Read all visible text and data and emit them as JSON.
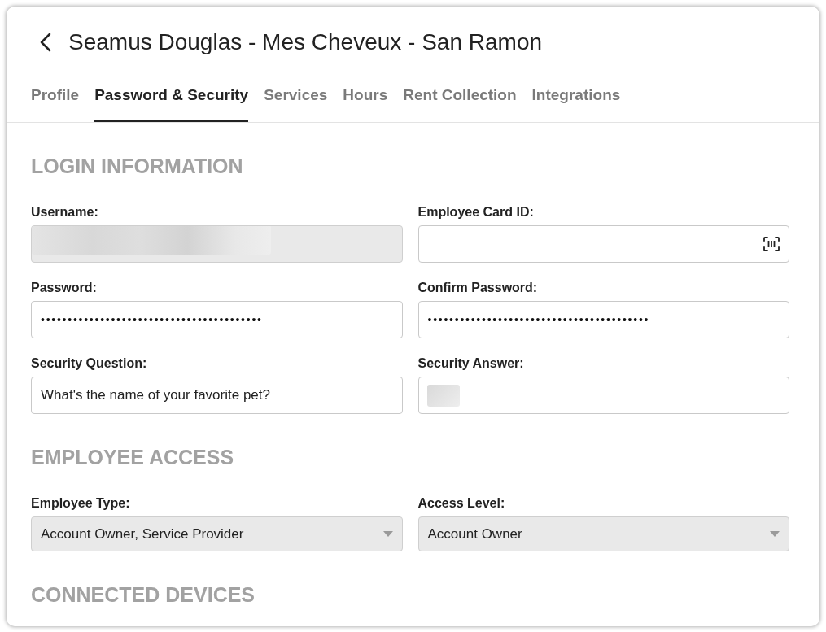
{
  "header": {
    "title": "Seamus Douglas - Mes Cheveux - San Ramon"
  },
  "tabs": [
    {
      "label": "Profile",
      "selected": false
    },
    {
      "label": "Password & Security",
      "selected": true
    },
    {
      "label": "Services",
      "selected": false
    },
    {
      "label": "Hours",
      "selected": false
    },
    {
      "label": "Rent Collection",
      "selected": false
    },
    {
      "label": "Integrations",
      "selected": false
    }
  ],
  "sections": [
    {
      "heading": "LOGIN INFORMATION",
      "fields": [
        {
          "kind": "text",
          "label": "Username:",
          "disabled": true,
          "blurred": true
        },
        {
          "kind": "scan",
          "label": "Employee Card ID:",
          "disabled": false,
          "blurred": false
        },
        {
          "kind": "password",
          "label": "Password:",
          "value": "•••••••••••••••••••••••••••••••••••••••••",
          "disabled": false,
          "blurred": false
        },
        {
          "kind": "password",
          "label": "Confirm Password:",
          "value": "•••••••••••••••••••••••••••••••••••••••••",
          "disabled": false,
          "blurred": false
        },
        {
          "kind": "text",
          "label": "Security Question:",
          "value": "What's the name of your favorite pet?",
          "disabled": false,
          "blurred": false
        },
        {
          "kind": "text",
          "label": "Security Answer:",
          "disabled": false,
          "blurred": true
        }
      ]
    },
    {
      "heading": "EMPLOYEE ACCESS",
      "fields": [
        {
          "kind": "select",
          "label": "Employee Type:",
          "value": "Account Owner, Service Provider",
          "disabled": true
        },
        {
          "kind": "select",
          "label": "Access Level:",
          "value": "Account Owner",
          "disabled": true
        }
      ]
    },
    {
      "heading": "CONNECTED DEVICES"
    }
  ]
}
